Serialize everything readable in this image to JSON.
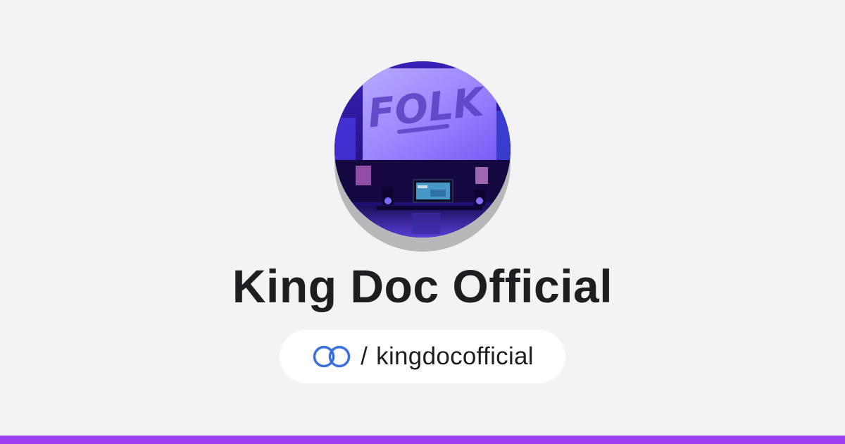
{
  "profile": {
    "name": "King Doc Official",
    "avatar_sign_text": "FOLK",
    "handle_prefix": "/",
    "handle": "kingdocofficial"
  },
  "icons": {
    "brand": "linked-rings-icon"
  },
  "colors": {
    "background": "#f3f3f6",
    "accent_bar": "#9b3df0",
    "brand_icon": "#3a6fe0",
    "text": "#1e1e22",
    "pill": "#ffffff"
  }
}
